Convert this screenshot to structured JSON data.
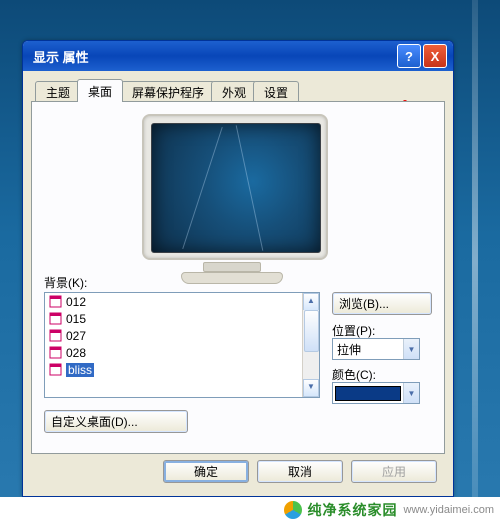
{
  "window": {
    "title": "显示 属性",
    "help_tooltip": "?",
    "close_tooltip": "X"
  },
  "tabs": {
    "theme": "主题",
    "desktop": "桌面",
    "screensaver": "屏幕保护程序",
    "appearance": "外观",
    "settings": "设置",
    "active": "desktop"
  },
  "desktopTab": {
    "background_label": "背景(K):",
    "items": [
      "012",
      "015",
      "027",
      "028",
      "bliss"
    ],
    "selected_index": 4,
    "browse_label": "浏览(B)...",
    "position_label": "位置(P):",
    "position_value": "拉伸",
    "color_label": "颜色(C):",
    "color_value": "#0a3a86",
    "customize_label": "自定义桌面(D)..."
  },
  "buttons": {
    "ok": "确定",
    "cancel": "取消",
    "apply": "应用"
  },
  "footer": {
    "brand_cn": "纯净系统家园",
    "brand_url": "www.yidaimei.com"
  }
}
